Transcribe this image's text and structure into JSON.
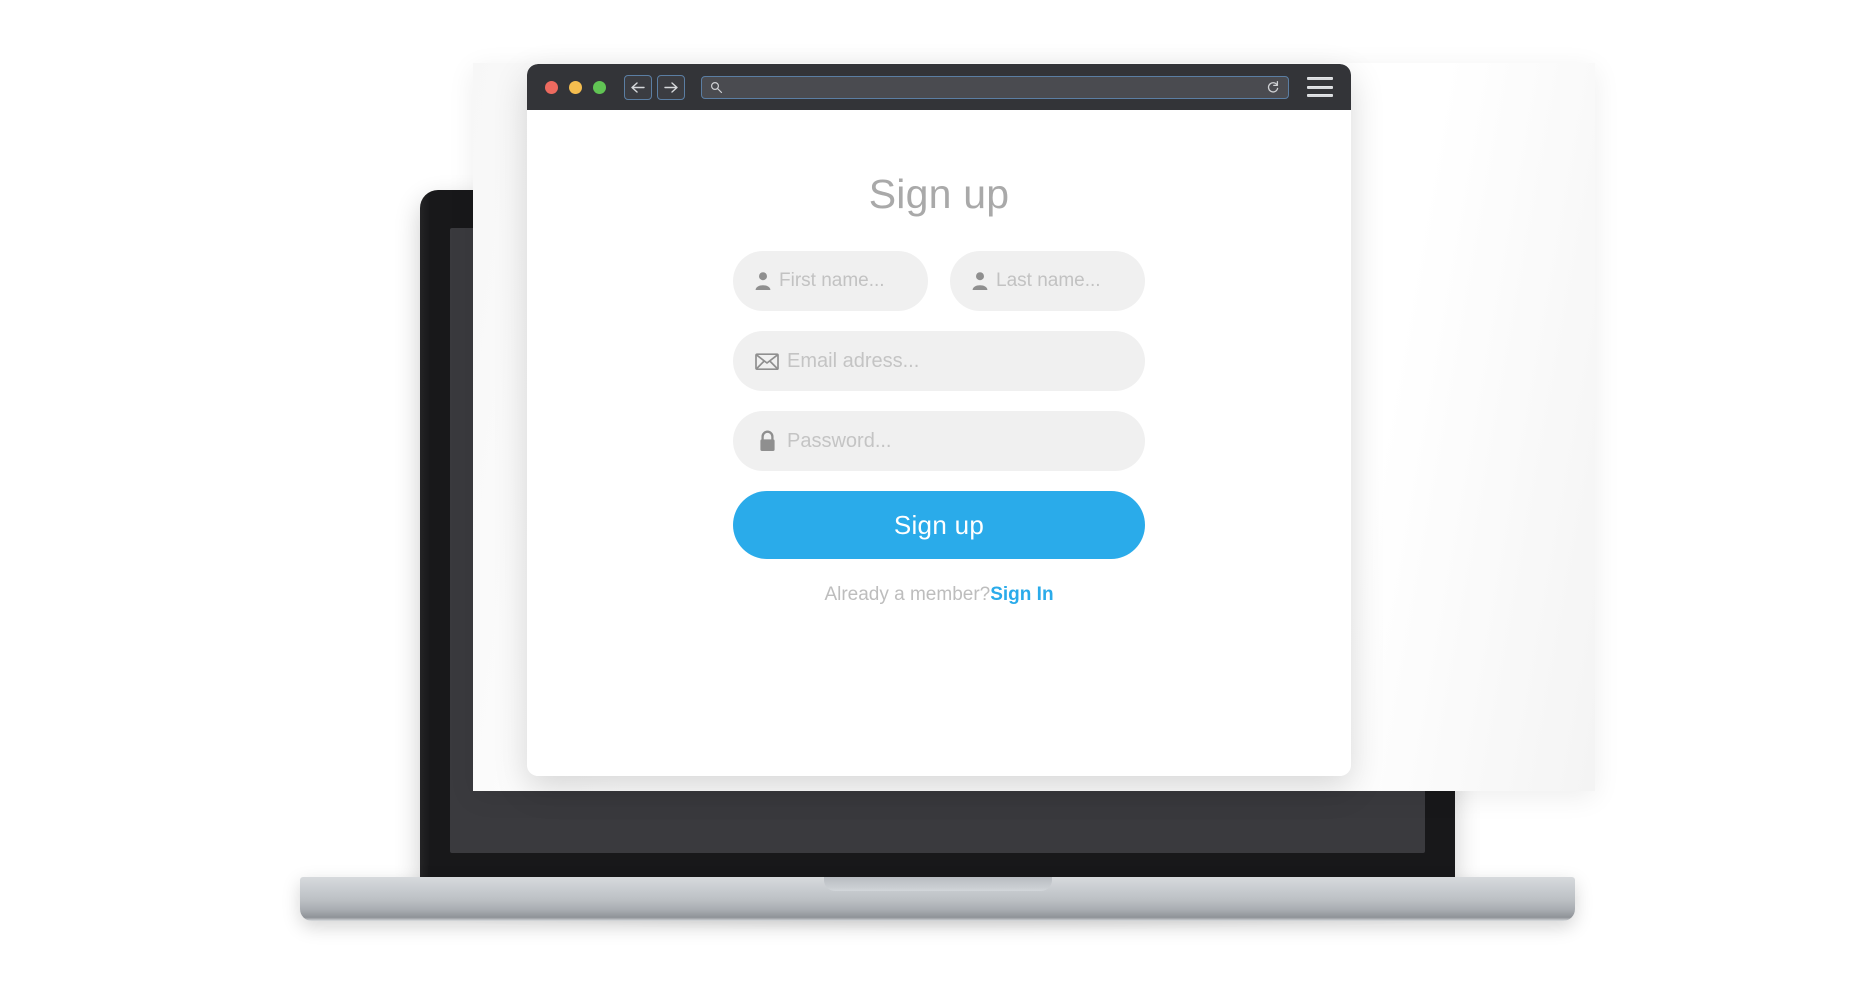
{
  "browser": {
    "traffic_lights": [
      {
        "name": "close",
        "color": "#ed6a5f"
      },
      {
        "name": "minimize",
        "color": "#f5bd4f"
      },
      {
        "name": "maximize",
        "color": "#61c454"
      }
    ],
    "back_label": "Back",
    "forward_label": "Forward",
    "address_value": "",
    "address_placeholder": "",
    "reload_label": "Reload",
    "menu_label": "Menu"
  },
  "page": {
    "title": "Sign up",
    "fields": [
      {
        "name": "first-name",
        "icon": "person-icon",
        "placeholder": "First name...",
        "value": "First name..."
      },
      {
        "name": "last-name",
        "icon": "person-icon",
        "placeholder": "Last name...",
        "value": "Last name..."
      },
      {
        "name": "email",
        "icon": "envelope-icon",
        "placeholder": "Email adress...",
        "value": "Email adress..."
      },
      {
        "name": "password",
        "icon": "lock-icon",
        "placeholder": "Password...",
        "value": "Password..."
      }
    ],
    "submit_label": "Sign up",
    "footer_text": "Already a member?",
    "footer_link": "Sign In"
  },
  "colors": {
    "accent": "#2aabea",
    "field_bg": "#f0f0f0",
    "placeholder": "#c2c2c2",
    "title": "#a9a9a9",
    "chrome": "#333438",
    "laptop_bezel": "#18181a",
    "laptop_screen": "#3a3a3e"
  }
}
